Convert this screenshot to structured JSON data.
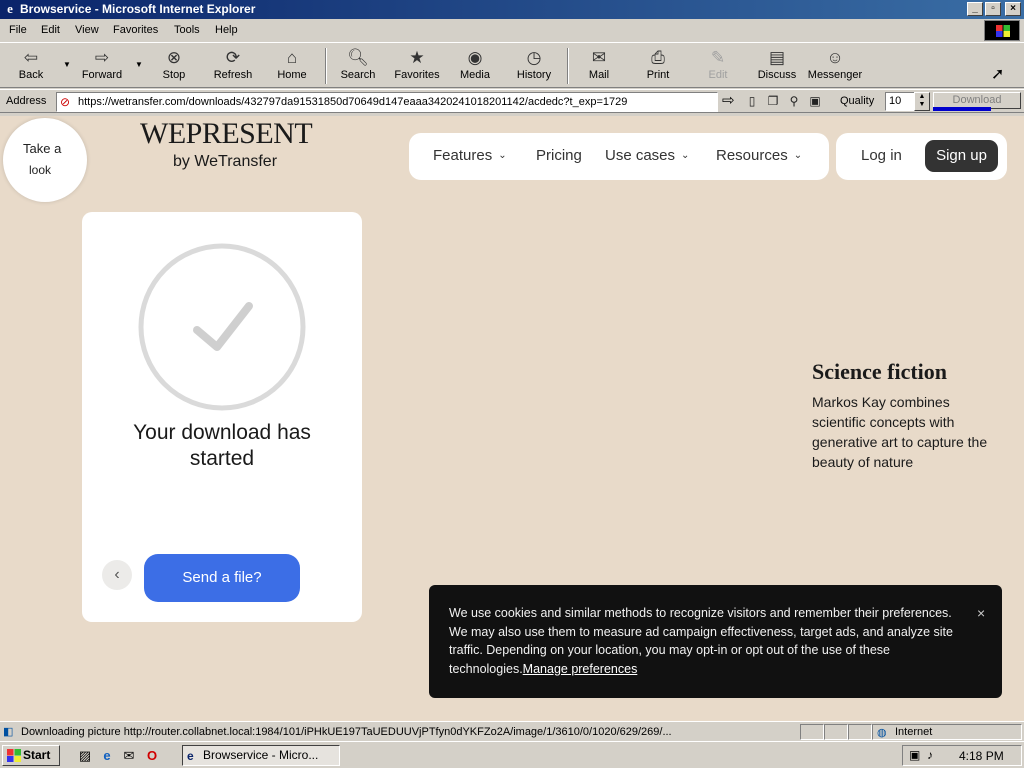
{
  "window": {
    "title": "Browservice - Microsoft Internet Explorer",
    "controls": [
      "_",
      "▫",
      "×"
    ]
  },
  "menu": [
    "File",
    "Edit",
    "View",
    "Favorites",
    "Tools",
    "Help"
  ],
  "toolbar": {
    "back": "Back",
    "forward": "Forward",
    "stop": "Stop",
    "refresh": "Refresh",
    "home": "Home",
    "search": "Search",
    "favorites": "Favorites",
    "media": "Media",
    "history": "History",
    "mail": "Mail",
    "print": "Print",
    "edit": "Edit",
    "discuss": "Discuss",
    "messenger": "Messenger"
  },
  "address": {
    "label": "Address",
    "url": "https://wetransfer.com/downloads/432797da91531850d70649d147eaaa3420241018201142/acdedc?t_exp=1729",
    "quality_label": "Quality",
    "quality_value": "10",
    "download_label": "Download"
  },
  "page": {
    "take_look": {
      "line1": "Take a",
      "line2": "look"
    },
    "brand": {
      "name": "WEPRESENT",
      "tagline": "by WeTransfer"
    },
    "nav": {
      "features": "Features",
      "pricing": "Pricing",
      "use_cases": "Use cases",
      "resources": "Resources",
      "login": "Log in",
      "signup": "Sign up"
    },
    "card": {
      "title": "Your download has started",
      "send_button": "Send a file?"
    },
    "feature": {
      "heading": "Science fiction",
      "text": "Markos Kay combines scientific concepts with generative art to capture the beauty of nature"
    },
    "cookie": {
      "text": "We use cookies and similar methods to recognize visitors and remember their preferences. We may also use them to measure ad campaign effectiveness, target ads, and analyze site traffic. Depending on your location, you may opt-in or opt out of the use of these technologies.",
      "link": "Manage preferences",
      "close": "×"
    }
  },
  "status": {
    "text": "Downloading picture http://router.collabnet.local:1984/101/iPHkUE197TaUEDUUVjPTfyn0dYKFZo2A/image/1/3610/0/1020/629/269/...",
    "zone": "Internet"
  },
  "taskbar": {
    "start": "Start",
    "task": "Browservice - Micro...",
    "clock": "4:18 PM"
  },
  "colors": {
    "page_background": "#e8dac9",
    "send_button": "#3c6ee6",
    "signup_button": "#333333",
    "cookie_banner": "#111111",
    "titlebar": "#0a246a"
  }
}
